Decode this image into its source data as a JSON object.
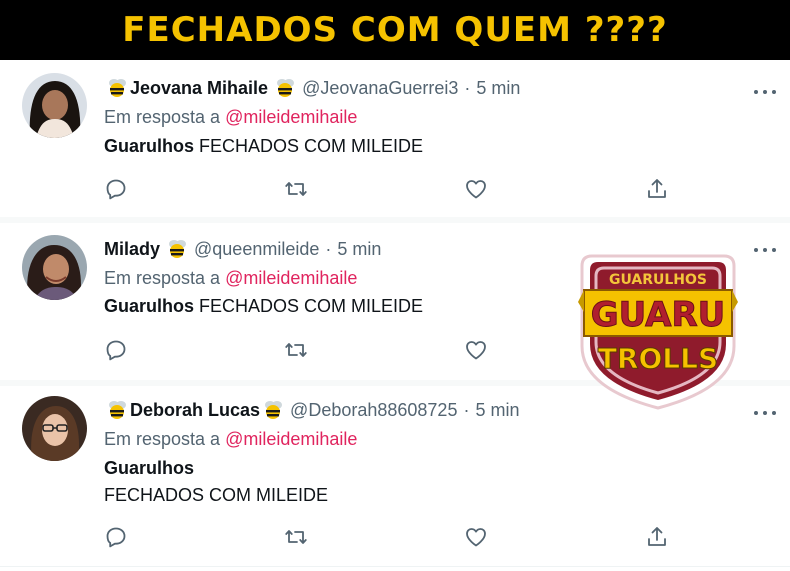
{
  "banner": {
    "title": "FECHADOS COM QUEM ????"
  },
  "colors": {
    "banner_bg": "#000000",
    "banner_text": "#f5c200",
    "mention": "#e0245e",
    "muted": "#536471"
  },
  "tweets": [
    {
      "name": "Jeovana Mihaile",
      "handle": "@JeovanaGuerrei3",
      "separator": "·",
      "time": "5 min",
      "reply_prefix": "Em resposta a",
      "reply_to": "@mileidemihaile",
      "body_bold": "Guarulhos",
      "body_text": "FECHADOS COM MILEIDE"
    },
    {
      "name": "Milady",
      "handle": "@queenmileide",
      "separator": "·",
      "time": "5 min",
      "reply_prefix": "Em resposta a",
      "reply_to": "@mileidemihaile",
      "body_bold": "Guarulhos",
      "body_text": "FECHADOS COM MILEIDE"
    },
    {
      "name": "Deborah Lucas",
      "handle": "@Deborah88608725",
      "separator": "·",
      "time": "5 min",
      "reply_prefix": "Em resposta a",
      "reply_to": "@mileidemihaile",
      "body_bold": "Guarulhos",
      "body_text": "FECHADOS COM MILEIDE"
    }
  ],
  "icons": {
    "reply": "reply-icon",
    "retweet": "retweet-icon",
    "like": "heart-icon",
    "share": "share-icon",
    "more": "more-icon",
    "bee": "bee-emoji-icon"
  },
  "logo": {
    "top": "GUARULHOS",
    "middle": "GUARU",
    "bottom": "TROLLS"
  }
}
